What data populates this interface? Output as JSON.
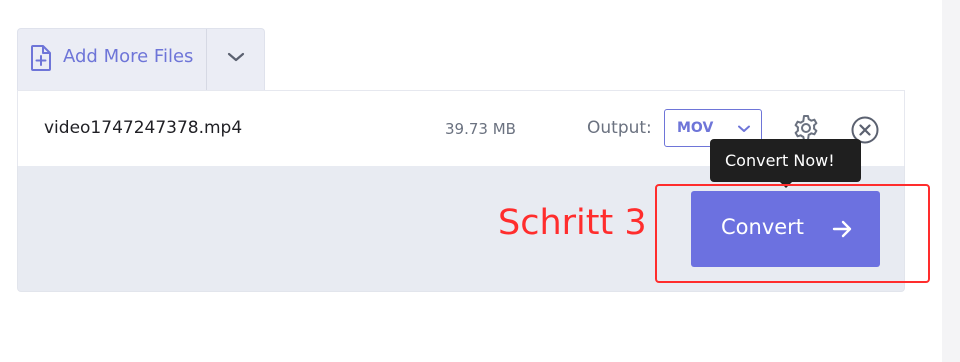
{
  "toolbar": {
    "add_files_label": "Add More Files",
    "icons": {
      "add": "file-plus-icon",
      "dropdown": "chevron-down-icon"
    }
  },
  "file": {
    "name": "video1747247378.mp4",
    "size": "39.73 MB",
    "output_label": "Output:",
    "format": "MOV",
    "icons": {
      "settings": "gear-icon",
      "remove": "close-circle-icon",
      "format_dropdown": "chevron-down-icon"
    }
  },
  "action": {
    "convert_label": "Convert",
    "tooltip": "Convert Now!",
    "convert_icon": "arrow-right-icon"
  },
  "annotation": {
    "step_label": "Schritt 3",
    "color": "#ff2d2d"
  },
  "colors": {
    "accent": "#6c71e0",
    "tab_bg": "#ebedf5",
    "bar_bg": "#e8ebf2"
  }
}
